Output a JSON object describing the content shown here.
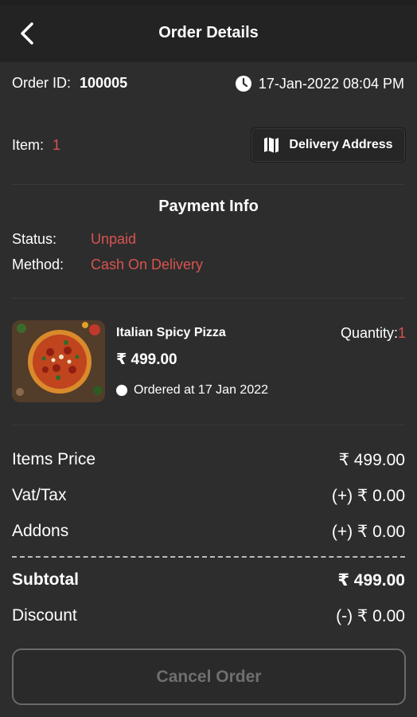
{
  "header": {
    "title": "Order Details"
  },
  "order": {
    "id_label": "Order ID:",
    "id_value": "100005",
    "datetime": "17-Jan-2022 08:04 PM",
    "item_label": "Item:",
    "item_value": "1"
  },
  "delivery_button": {
    "label": "Delivery Address"
  },
  "payment": {
    "title": "Payment Info",
    "status_label": "Status:",
    "status_value": "Unpaid",
    "method_label": "Method:",
    "method_value": "Cash On Delivery"
  },
  "items": [
    {
      "name": "Italian Spicy Pizza",
      "price": "₹ 499.00",
      "quantity_label": "Quantity:",
      "quantity_value": "1",
      "ordered_at": "Ordered at 17 Jan 2022"
    }
  ],
  "summary": {
    "items_price_label": "Items Price",
    "items_price_value": "₹ 499.00",
    "vat_label": "Vat/Tax",
    "vat_value": "(+) ₹ 0.00",
    "addons_label": "Addons",
    "addons_value": "(+) ₹ 0.00",
    "subtotal_label": "Subtotal",
    "subtotal_value": "₹ 499.00",
    "discount_label": "Discount",
    "discount_value": "(-) ₹ 0.00"
  },
  "cancel_button": {
    "label": "Cancel Order"
  },
  "colors": {
    "background": "#2d2d2d",
    "appbar": "#232323",
    "accent": "#d9534f",
    "text": "#ffffff",
    "disabled_text": "#6f6f6f"
  },
  "icons": {
    "back": "chevron-left-icon",
    "clock": "clock-icon",
    "map": "map-icon",
    "dot": "bullet-dot-icon"
  }
}
